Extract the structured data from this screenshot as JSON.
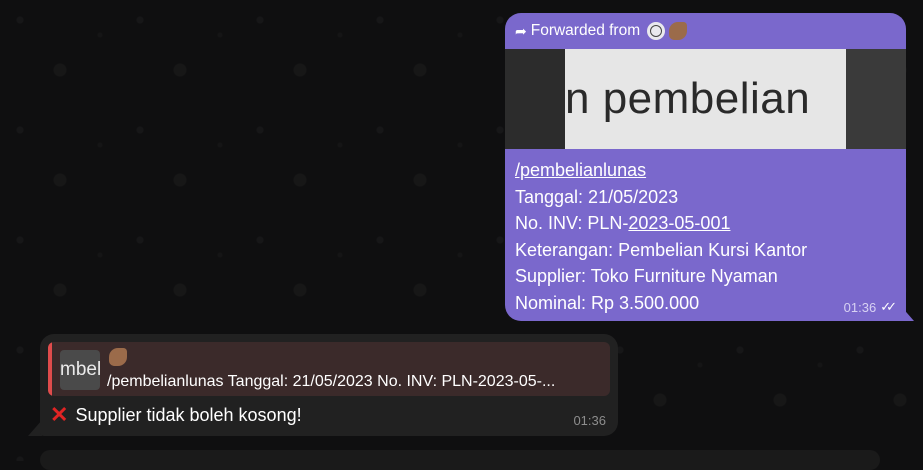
{
  "outgoing": {
    "forward_label": "Forwarded from",
    "preview_text": "n pembelian",
    "command": "/pembelianlunas",
    "tanggal": "Tanggal: 21/05/2023",
    "inv_prefix": "No. INV: PLN-",
    "inv_link": "2023-05-001",
    "keterangan": "Keterangan: Pembelian Kursi Kantor",
    "supplier": "Supplier: Toko Furniture Nyaman",
    "nominal": "Nominal: Rp 3.500.000",
    "time": "01:36",
    "accent_color": "#7a68cc"
  },
  "incoming": {
    "reply_thumb_text": "mbel",
    "reply_text": "/pembelianlunas Tanggal: 21/05/2023 No. INV: PLN-2023-05-...",
    "message": "Supplier tidak boleh kosong!",
    "time": "01:36",
    "reply_bar_color": "#e04c4c"
  },
  "icons": {
    "forward": "forward-arrow-icon",
    "globe": "globe-icon",
    "bird": "bird-avatar-icon",
    "read_status": "double-check-icon",
    "error": "red-cross-icon"
  }
}
